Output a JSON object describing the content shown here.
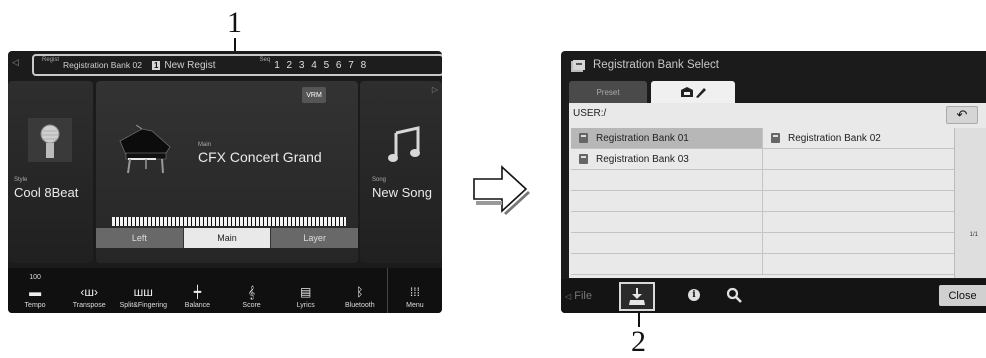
{
  "callouts": {
    "one": "1",
    "two": "2"
  },
  "home": {
    "reg_tiny": "Regist",
    "reg_bank": "Registration Bank 02",
    "reg_badge": "1",
    "reg_name": "New Regist",
    "seq_tiny": "Seq",
    "seq_numbers": "1 2 3 4 5 6 7 8",
    "style_label": "Style",
    "style_value": "Cool 8Beat",
    "main_label": "Main",
    "main_value": "CFX Concert Grand",
    "vrm": "VRM",
    "song_label": "Song",
    "song_value": "New Song",
    "parts": [
      "Left",
      "Main",
      "Layer"
    ],
    "tempo_value": "100",
    "bottom": [
      {
        "label": "Tempo",
        "icon": "tempo-icon"
      },
      {
        "label": "Transpose",
        "icon": "transpose-icon"
      },
      {
        "label": "Split&Fingering",
        "icon": "split-fingering-icon"
      },
      {
        "label": "Balance",
        "icon": "balance-icon"
      },
      {
        "label": "Score",
        "icon": "score-icon"
      },
      {
        "label": "Lyrics",
        "icon": "lyrics-icon"
      },
      {
        "label": "Bluetooth",
        "icon": "bluetooth-icon"
      },
      {
        "label": "Menu",
        "icon": "menu-icon"
      }
    ]
  },
  "regsel": {
    "title": "Registration Bank Select",
    "tab_preset": "Preset",
    "path": "USER:/",
    "files": [
      "Registration Bank 01",
      "Registration Bank 02",
      "Registration Bank 03"
    ],
    "page": "1/1",
    "file_label": "File",
    "close_label": "Close"
  },
  "colors": {
    "screen_bg": "#1b1b1b",
    "list_bg": "#e9e9e9",
    "selected_row": "#b7b7b7"
  }
}
